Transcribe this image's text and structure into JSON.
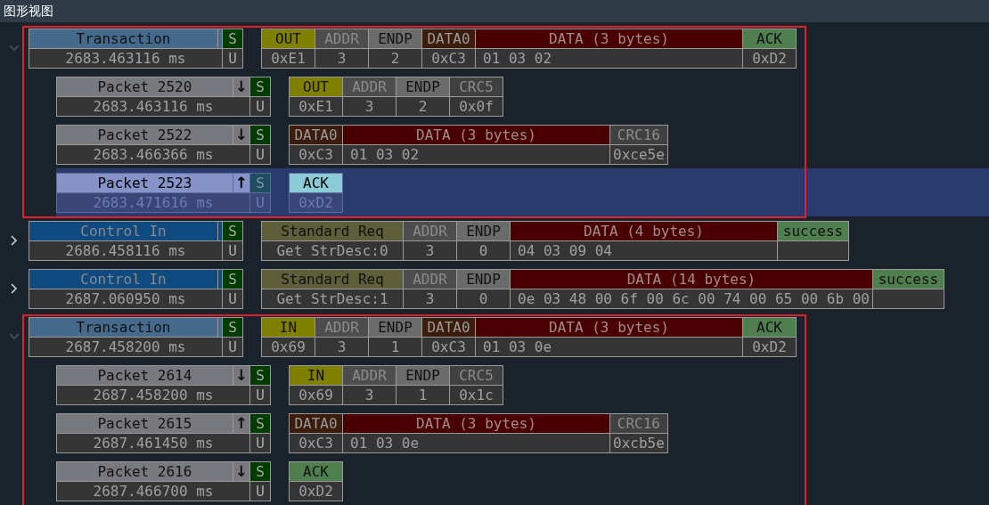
{
  "title": "图形视图",
  "groups": [
    {
      "expanded": true,
      "marked": true,
      "record": {
        "kind": "transaction",
        "title": "Transaction",
        "flag_top": "S",
        "time": "2683.463116 ms",
        "flag_bottom": "U",
        "selected": false,
        "fields": [
          {
            "kind": "token",
            "name": "OUT",
            "value": "0xE1"
          },
          {
            "kind": "addr",
            "name": "ADDR",
            "value": "3"
          },
          {
            "kind": "endp",
            "name": "ENDP",
            "value": "2"
          },
          {
            "kind": "pid",
            "name": "DATA0",
            "value": "0xC3"
          },
          {
            "kind": "data",
            "name": "DATA (3 bytes)",
            "value": "01 03 02"
          },
          {
            "kind": "handshake",
            "name": "ACK",
            "value": "0xD2"
          }
        ]
      },
      "children": [
        {
          "kind": "packet",
          "title": "Packet 2520",
          "direction": "↓",
          "flag_top": "S",
          "time": "2683.463116 ms",
          "flag_bottom": "U",
          "selected": false,
          "fields": [
            {
              "kind": "token",
              "name": "OUT",
              "value": "0xE1"
            },
            {
              "kind": "addr",
              "name": "ADDR",
              "value": "3"
            },
            {
              "kind": "endp",
              "name": "ENDP",
              "value": "2"
            },
            {
              "kind": "crc",
              "name": "CRC5",
              "value": "0x0f"
            }
          ]
        },
        {
          "kind": "packet",
          "title": "Packet 2522",
          "direction": "↓",
          "flag_top": "S",
          "time": "2683.466366 ms",
          "flag_bottom": "U",
          "selected": false,
          "fields": [
            {
              "kind": "pid",
              "name": "DATA0",
              "value": "0xC3"
            },
            {
              "kind": "data",
              "name": "DATA (3 bytes)",
              "value": "01 03 02"
            },
            {
              "kind": "crc",
              "name": "CRC16",
              "value": "0xce5e"
            }
          ]
        },
        {
          "kind": "packet",
          "title": "Packet 2523",
          "direction": "↑",
          "flag_top": "S",
          "time": "2683.471616 ms",
          "flag_bottom": "U",
          "selected": true,
          "fields": [
            {
              "kind": "handshake",
              "name": "ACK",
              "value": "0xD2"
            }
          ]
        }
      ]
    },
    {
      "expanded": false,
      "marked": false,
      "record": {
        "kind": "control",
        "title": "Control In",
        "flag_top": "S",
        "time": "2686.458116 ms",
        "flag_bottom": "U",
        "selected": false,
        "fields": [
          {
            "kind": "request",
            "name": "Standard Req",
            "value": "Get StrDesc:0"
          },
          {
            "kind": "addr",
            "name": "ADDR",
            "value": "3"
          },
          {
            "kind": "endp",
            "name": "ENDP",
            "value": "0"
          },
          {
            "kind": "data",
            "name": "DATA (4 bytes)",
            "value": "04 03 09 04"
          },
          {
            "kind": "status",
            "name": "success"
          }
        ]
      }
    },
    {
      "expanded": false,
      "marked": false,
      "record": {
        "kind": "control",
        "title": "Control In",
        "flag_top": "S",
        "time": "2687.060950 ms",
        "flag_bottom": "U",
        "selected": false,
        "fields": [
          {
            "kind": "request",
            "name": "Standard Req",
            "value": "Get StrDesc:1"
          },
          {
            "kind": "addr",
            "name": "ADDR",
            "value": "3"
          },
          {
            "kind": "endp",
            "name": "ENDP",
            "value": "0"
          },
          {
            "kind": "data",
            "name": "DATA (14 bytes)",
            "value": "0e 03 48 00 6f 00 6c 00 74 00 65 00 6b 00"
          },
          {
            "kind": "status",
            "name": "success"
          }
        ]
      }
    },
    {
      "expanded": true,
      "marked": true,
      "record": {
        "kind": "transaction",
        "title": "Transaction",
        "flag_top": "S",
        "time": "2687.458200 ms",
        "flag_bottom": "U",
        "selected": false,
        "fields": [
          {
            "kind": "token",
            "name": "IN",
            "value": "0x69"
          },
          {
            "kind": "addr",
            "name": "ADDR",
            "value": "3"
          },
          {
            "kind": "endp",
            "name": "ENDP",
            "value": "1"
          },
          {
            "kind": "pid",
            "name": "DATA0",
            "value": "0xC3"
          },
          {
            "kind": "data",
            "name": "DATA (3 bytes)",
            "value": "01 03 0e"
          },
          {
            "kind": "handshake",
            "name": "ACK",
            "value": "0xD2"
          }
        ]
      },
      "children": [
        {
          "kind": "packet",
          "title": "Packet 2614",
          "direction": "↓",
          "flag_top": "S",
          "time": "2687.458200 ms",
          "flag_bottom": "U",
          "selected": false,
          "fields": [
            {
              "kind": "token",
              "name": "IN",
              "value": "0x69"
            },
            {
              "kind": "addr",
              "name": "ADDR",
              "value": "3"
            },
            {
              "kind": "endp",
              "name": "ENDP",
              "value": "1"
            },
            {
              "kind": "crc",
              "name": "CRC5",
              "value": "0x1c"
            }
          ]
        },
        {
          "kind": "packet",
          "title": "Packet 2615",
          "direction": "↑",
          "flag_top": "S",
          "time": "2687.461450 ms",
          "flag_bottom": "U",
          "selected": false,
          "fields": [
            {
              "kind": "pid",
              "name": "DATA0",
              "value": "0xC3"
            },
            {
              "kind": "data",
              "name": "DATA (3 bytes)",
              "value": "01 03 0e"
            },
            {
              "kind": "crc",
              "name": "CRC16",
              "value": "0xcb5e"
            }
          ]
        },
        {
          "kind": "packet",
          "title": "Packet 2616",
          "direction": "↓",
          "flag_top": "S",
          "time": "2687.466700 ms",
          "flag_bottom": "U",
          "selected": false,
          "fields": [
            {
              "kind": "handshake",
              "name": "ACK",
              "value": "0xD2"
            }
          ]
        }
      ]
    }
  ]
}
